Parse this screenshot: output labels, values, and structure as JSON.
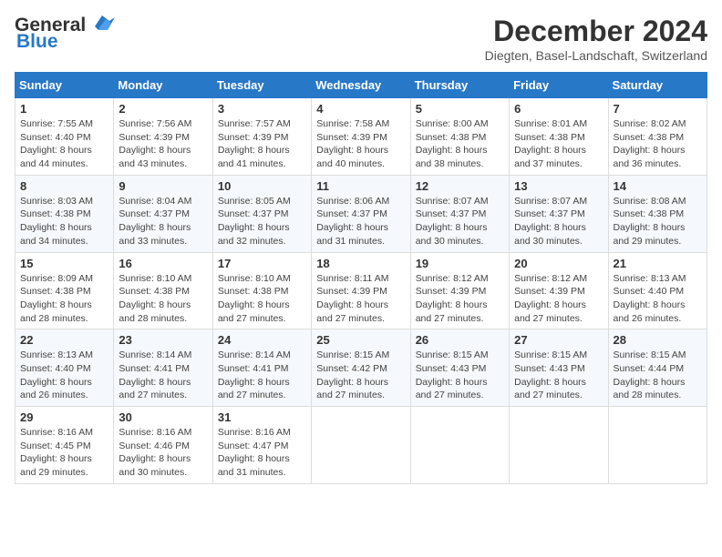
{
  "header": {
    "logo_general": "General",
    "logo_blue": "Blue",
    "month_title": "December 2024",
    "location": "Diegten, Basel-Landschaft, Switzerland"
  },
  "days_of_week": [
    "Sunday",
    "Monday",
    "Tuesday",
    "Wednesday",
    "Thursday",
    "Friday",
    "Saturday"
  ],
  "weeks": [
    [
      {
        "day": "1",
        "sunrise": "Sunrise: 7:55 AM",
        "sunset": "Sunset: 4:40 PM",
        "daylight": "Daylight: 8 hours and 44 minutes."
      },
      {
        "day": "2",
        "sunrise": "Sunrise: 7:56 AM",
        "sunset": "Sunset: 4:39 PM",
        "daylight": "Daylight: 8 hours and 43 minutes."
      },
      {
        "day": "3",
        "sunrise": "Sunrise: 7:57 AM",
        "sunset": "Sunset: 4:39 PM",
        "daylight": "Daylight: 8 hours and 41 minutes."
      },
      {
        "day": "4",
        "sunrise": "Sunrise: 7:58 AM",
        "sunset": "Sunset: 4:39 PM",
        "daylight": "Daylight: 8 hours and 40 minutes."
      },
      {
        "day": "5",
        "sunrise": "Sunrise: 8:00 AM",
        "sunset": "Sunset: 4:38 PM",
        "daylight": "Daylight: 8 hours and 38 minutes."
      },
      {
        "day": "6",
        "sunrise": "Sunrise: 8:01 AM",
        "sunset": "Sunset: 4:38 PM",
        "daylight": "Daylight: 8 hours and 37 minutes."
      },
      {
        "day": "7",
        "sunrise": "Sunrise: 8:02 AM",
        "sunset": "Sunset: 4:38 PM",
        "daylight": "Daylight: 8 hours and 36 minutes."
      }
    ],
    [
      {
        "day": "8",
        "sunrise": "Sunrise: 8:03 AM",
        "sunset": "Sunset: 4:38 PM",
        "daylight": "Daylight: 8 hours and 34 minutes."
      },
      {
        "day": "9",
        "sunrise": "Sunrise: 8:04 AM",
        "sunset": "Sunset: 4:37 PM",
        "daylight": "Daylight: 8 hours and 33 minutes."
      },
      {
        "day": "10",
        "sunrise": "Sunrise: 8:05 AM",
        "sunset": "Sunset: 4:37 PM",
        "daylight": "Daylight: 8 hours and 32 minutes."
      },
      {
        "day": "11",
        "sunrise": "Sunrise: 8:06 AM",
        "sunset": "Sunset: 4:37 PM",
        "daylight": "Daylight: 8 hours and 31 minutes."
      },
      {
        "day": "12",
        "sunrise": "Sunrise: 8:07 AM",
        "sunset": "Sunset: 4:37 PM",
        "daylight": "Daylight: 8 hours and 30 minutes."
      },
      {
        "day": "13",
        "sunrise": "Sunrise: 8:07 AM",
        "sunset": "Sunset: 4:37 PM",
        "daylight": "Daylight: 8 hours and 30 minutes."
      },
      {
        "day": "14",
        "sunrise": "Sunrise: 8:08 AM",
        "sunset": "Sunset: 4:38 PM",
        "daylight": "Daylight: 8 hours and 29 minutes."
      }
    ],
    [
      {
        "day": "15",
        "sunrise": "Sunrise: 8:09 AM",
        "sunset": "Sunset: 4:38 PM",
        "daylight": "Daylight: 8 hours and 28 minutes."
      },
      {
        "day": "16",
        "sunrise": "Sunrise: 8:10 AM",
        "sunset": "Sunset: 4:38 PM",
        "daylight": "Daylight: 8 hours and 28 minutes."
      },
      {
        "day": "17",
        "sunrise": "Sunrise: 8:10 AM",
        "sunset": "Sunset: 4:38 PM",
        "daylight": "Daylight: 8 hours and 27 minutes."
      },
      {
        "day": "18",
        "sunrise": "Sunrise: 8:11 AM",
        "sunset": "Sunset: 4:39 PM",
        "daylight": "Daylight: 8 hours and 27 minutes."
      },
      {
        "day": "19",
        "sunrise": "Sunrise: 8:12 AM",
        "sunset": "Sunset: 4:39 PM",
        "daylight": "Daylight: 8 hours and 27 minutes."
      },
      {
        "day": "20",
        "sunrise": "Sunrise: 8:12 AM",
        "sunset": "Sunset: 4:39 PM",
        "daylight": "Daylight: 8 hours and 27 minutes."
      },
      {
        "day": "21",
        "sunrise": "Sunrise: 8:13 AM",
        "sunset": "Sunset: 4:40 PM",
        "daylight": "Daylight: 8 hours and 26 minutes."
      }
    ],
    [
      {
        "day": "22",
        "sunrise": "Sunrise: 8:13 AM",
        "sunset": "Sunset: 4:40 PM",
        "daylight": "Daylight: 8 hours and 26 minutes."
      },
      {
        "day": "23",
        "sunrise": "Sunrise: 8:14 AM",
        "sunset": "Sunset: 4:41 PM",
        "daylight": "Daylight: 8 hours and 27 minutes."
      },
      {
        "day": "24",
        "sunrise": "Sunrise: 8:14 AM",
        "sunset": "Sunset: 4:41 PM",
        "daylight": "Daylight: 8 hours and 27 minutes."
      },
      {
        "day": "25",
        "sunrise": "Sunrise: 8:15 AM",
        "sunset": "Sunset: 4:42 PM",
        "daylight": "Daylight: 8 hours and 27 minutes."
      },
      {
        "day": "26",
        "sunrise": "Sunrise: 8:15 AM",
        "sunset": "Sunset: 4:43 PM",
        "daylight": "Daylight: 8 hours and 27 minutes."
      },
      {
        "day": "27",
        "sunrise": "Sunrise: 8:15 AM",
        "sunset": "Sunset: 4:43 PM",
        "daylight": "Daylight: 8 hours and 27 minutes."
      },
      {
        "day": "28",
        "sunrise": "Sunrise: 8:15 AM",
        "sunset": "Sunset: 4:44 PM",
        "daylight": "Daylight: 8 hours and 28 minutes."
      }
    ],
    [
      {
        "day": "29",
        "sunrise": "Sunrise: 8:16 AM",
        "sunset": "Sunset: 4:45 PM",
        "daylight": "Daylight: 8 hours and 29 minutes."
      },
      {
        "day": "30",
        "sunrise": "Sunrise: 8:16 AM",
        "sunset": "Sunset: 4:46 PM",
        "daylight": "Daylight: 8 hours and 30 minutes."
      },
      {
        "day": "31",
        "sunrise": "Sunrise: 8:16 AM",
        "sunset": "Sunset: 4:47 PM",
        "daylight": "Daylight: 8 hours and 31 minutes."
      },
      null,
      null,
      null,
      null
    ]
  ]
}
